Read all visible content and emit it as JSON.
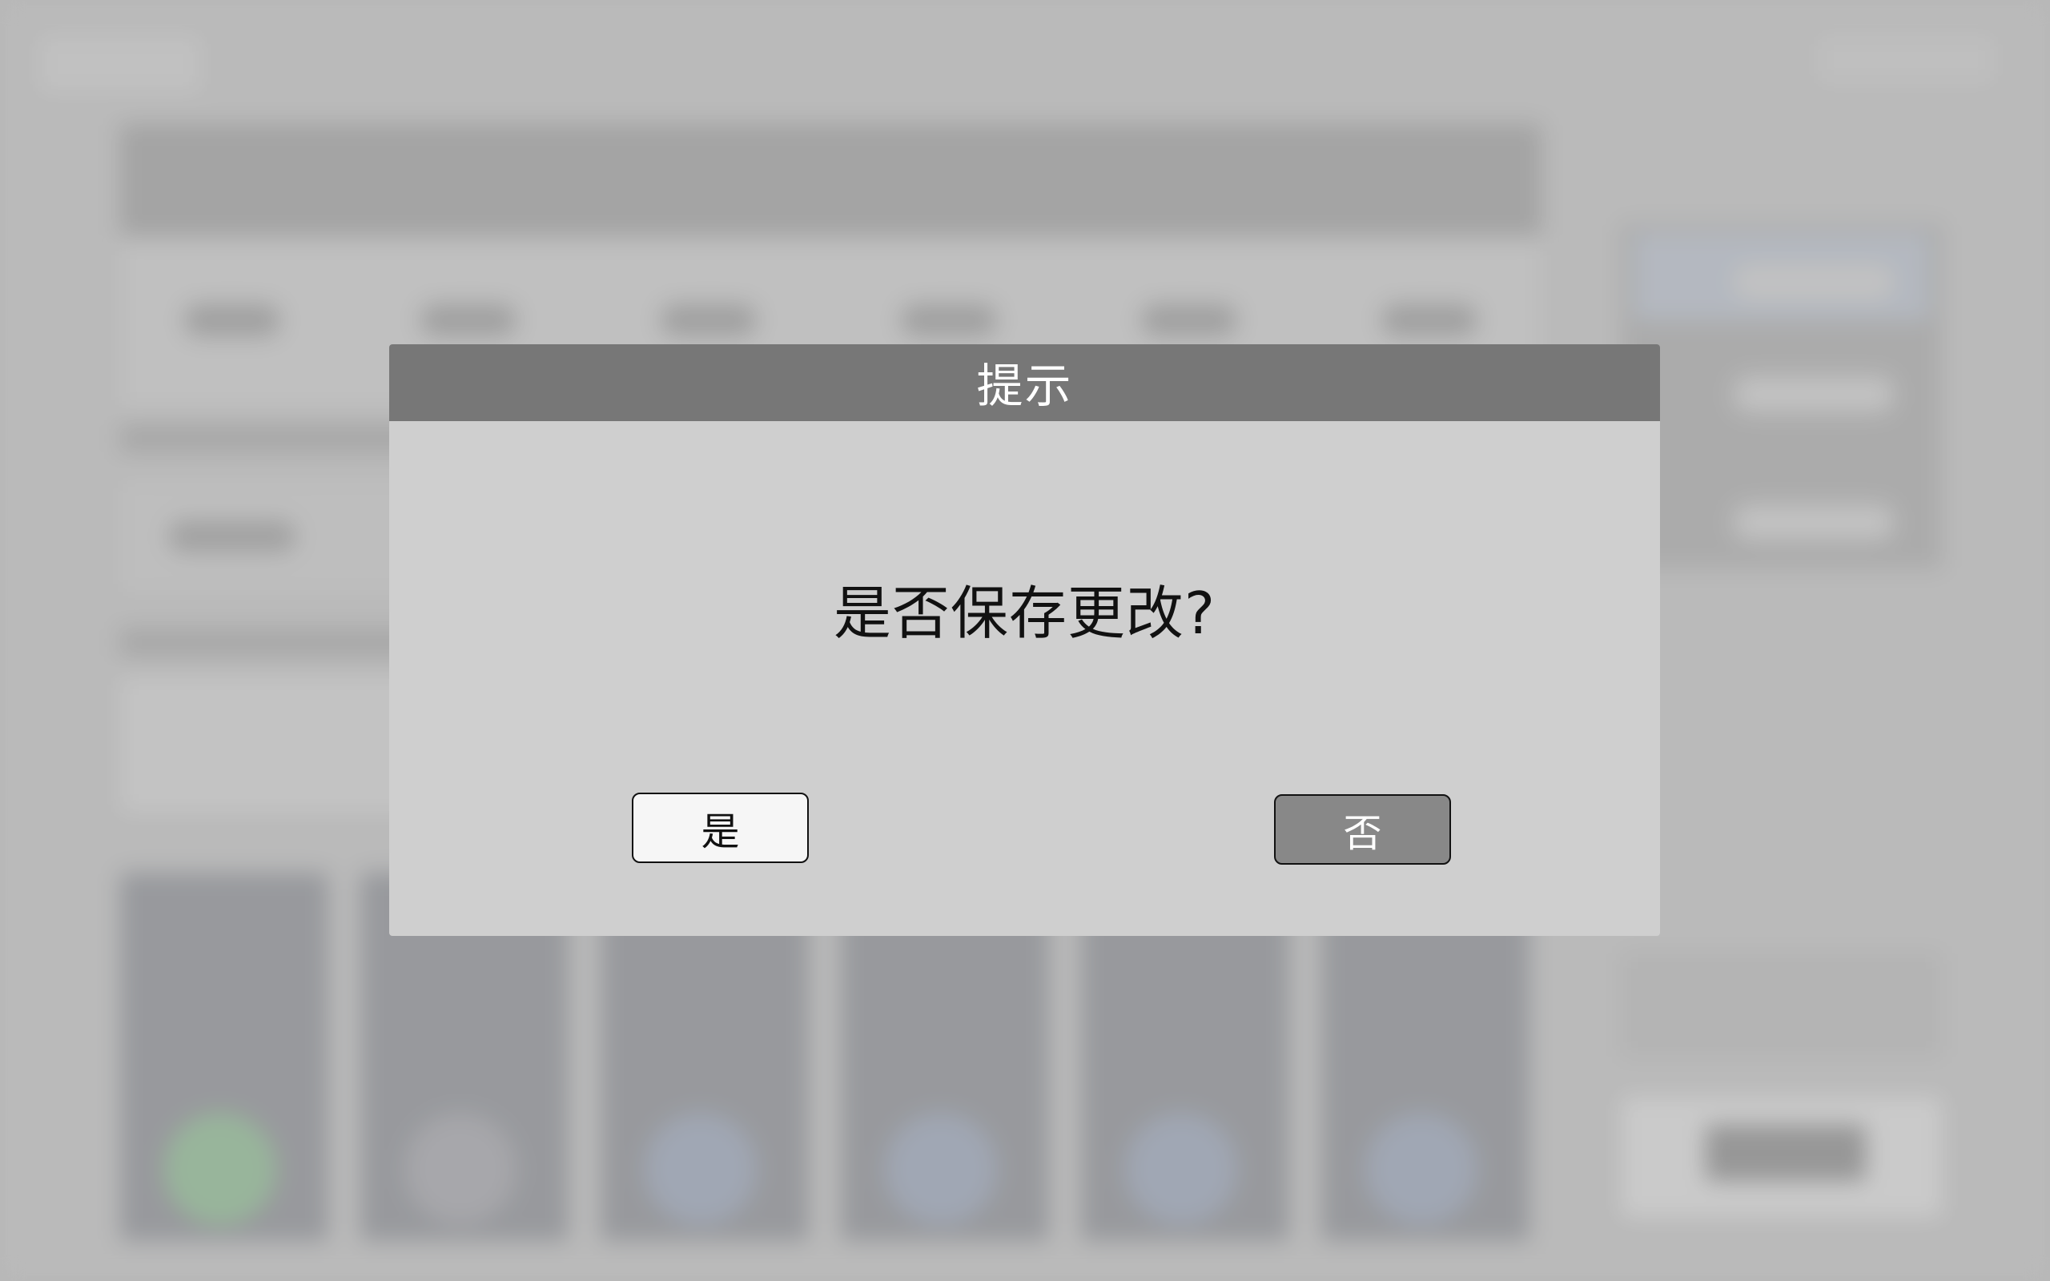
{
  "dialog": {
    "title": "提示",
    "message": "是否保存更改?",
    "yes_label": "是",
    "no_label": "否"
  },
  "colors": {
    "titlebar": "#777777",
    "dialog_body": "#cfcfcf",
    "yes_button": "#f6f6f6",
    "no_button": "#888888"
  }
}
